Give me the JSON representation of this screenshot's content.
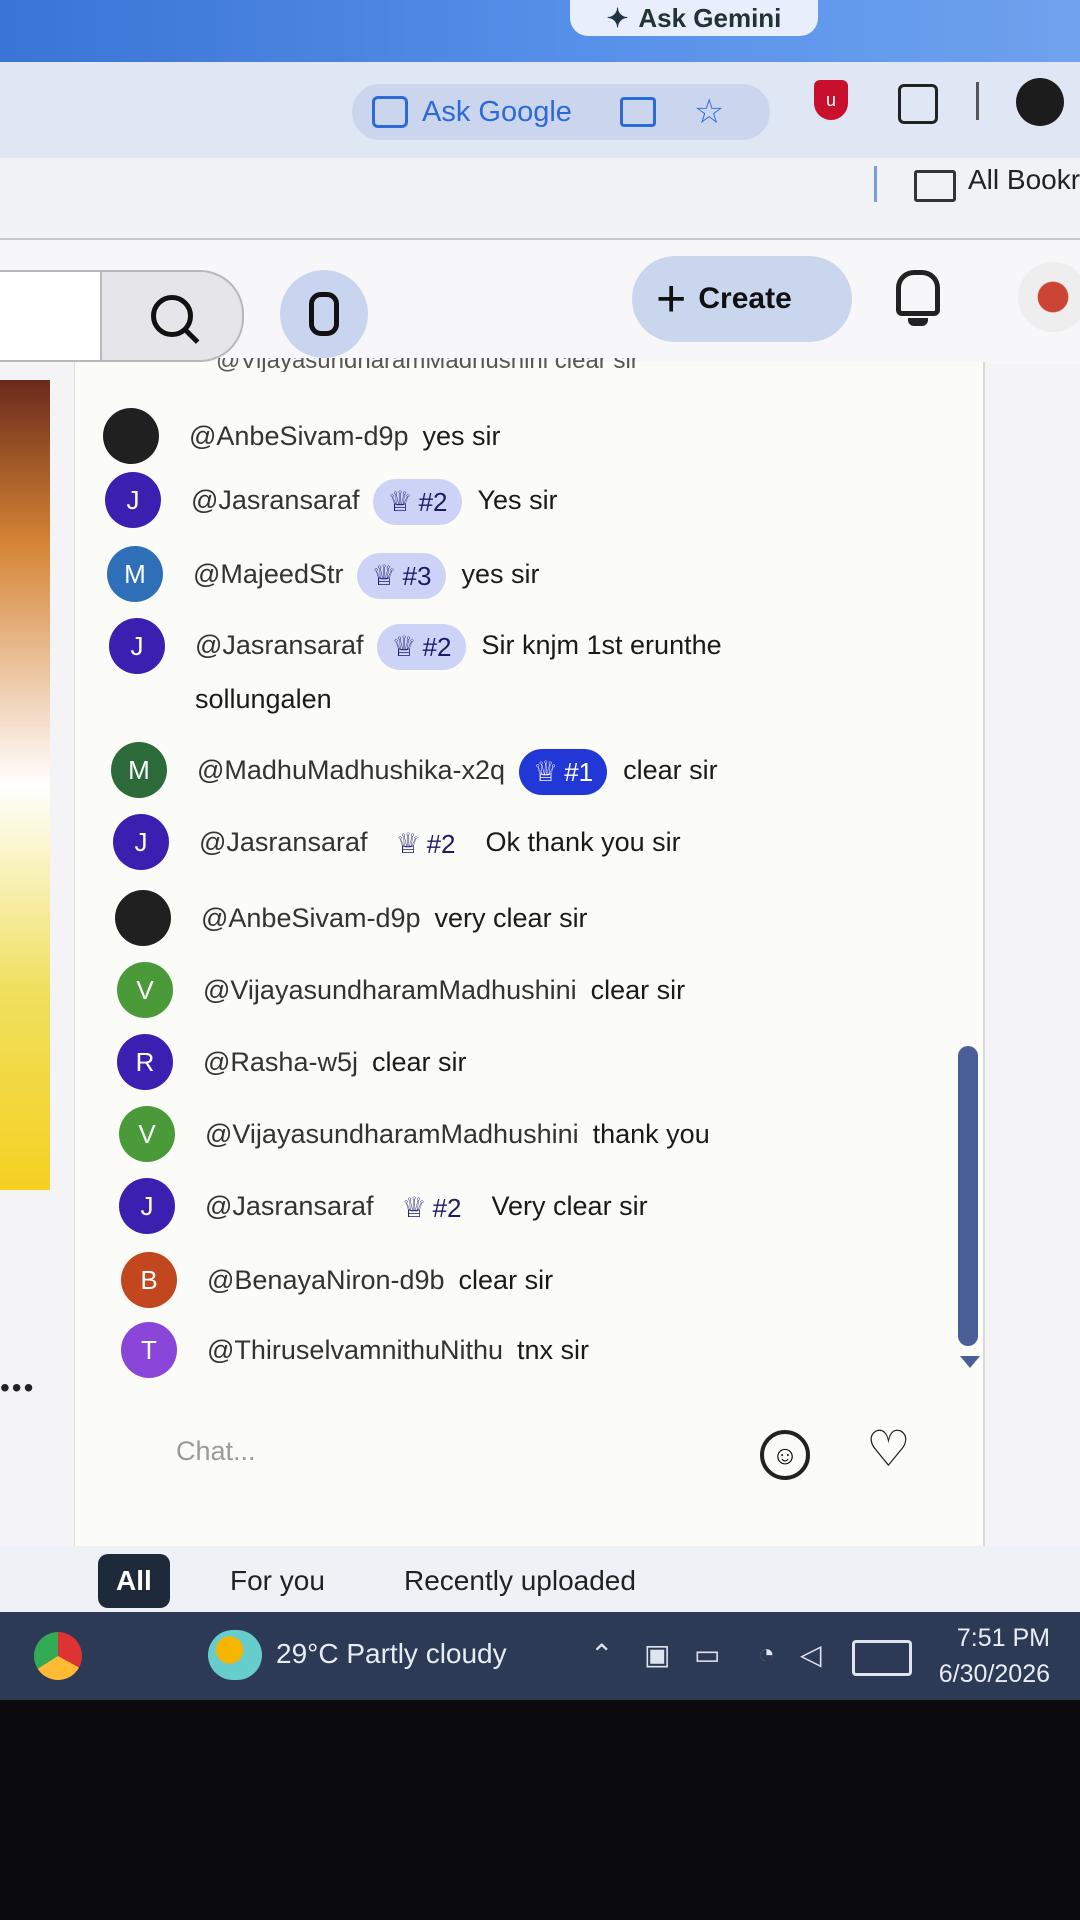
{
  "browser": {
    "gemini_label": "Ask Gemini",
    "ask_google_label": "Ask Google",
    "bookmarks_label": "All Bookr"
  },
  "youtube": {
    "create_label": "Create"
  },
  "chat": {
    "cut_message": "@VijayasundharamMadhushini clear sir",
    "messages": [
      {
        "initial": "",
        "color": "#202020",
        "author": "@AnbeSivam-d9p",
        "badge": "",
        "text": "yes sir"
      },
      {
        "initial": "J",
        "color": "#3b1fb0",
        "author": "@Jasransaraf",
        "badge": "#2",
        "text": "Yes sir"
      },
      {
        "initial": "M",
        "color": "#2f6fb8",
        "author": "@MajeedStr",
        "badge": "#3",
        "text": "yes sir"
      },
      {
        "initial": "J",
        "color": "#3b1fb0",
        "author": "@Jasransaraf",
        "badge": "#2",
        "text": "Sir knjm 1st erunthe sollungalen"
      },
      {
        "initial": "M",
        "color": "#2d6a3a",
        "author": "@MadhuMadhushika-x2q",
        "badge": "#1",
        "text": "clear sir"
      },
      {
        "initial": "J",
        "color": "#3b1fb0",
        "author": "@Jasransaraf",
        "badge": "#2",
        "text": "Ok thank you sir"
      },
      {
        "initial": "",
        "color": "#202020",
        "author": "@AnbeSivam-d9p",
        "badge": "",
        "text": "very clear sir"
      },
      {
        "initial": "V",
        "color": "#4a9a3a",
        "author": "@VijayasundharamMadhushini",
        "badge": "",
        "text": "clear sir"
      },
      {
        "initial": "R",
        "color": "#3b1fb0",
        "author": "@Rasha-w5j",
        "badge": "",
        "text": "clear sir"
      },
      {
        "initial": "V",
        "color": "#4a9a3a",
        "author": "@VijayasundharamMadhushini",
        "badge": "",
        "text": "thank you"
      },
      {
        "initial": "J",
        "color": "#3b1fb0",
        "author": "@Jasransaraf",
        "badge": "#2",
        "text": "Very clear sir"
      },
      {
        "initial": "B",
        "color": "#c2461e",
        "author": "@BenayaNiron-d9b",
        "badge": "",
        "text": "clear sir"
      },
      {
        "initial": "T",
        "color": "#8a46d8",
        "author": "@ThiruselvamnithuNithu",
        "badge": "",
        "text": "tnx sir"
      }
    ],
    "input_placeholder": "Chat..."
  },
  "chips": [
    "All",
    "For you",
    "Recently uploaded"
  ],
  "taskbar": {
    "weather": "29°C  Partly cloudy",
    "time": "7:51 PM",
    "date": "6/30/2026"
  }
}
